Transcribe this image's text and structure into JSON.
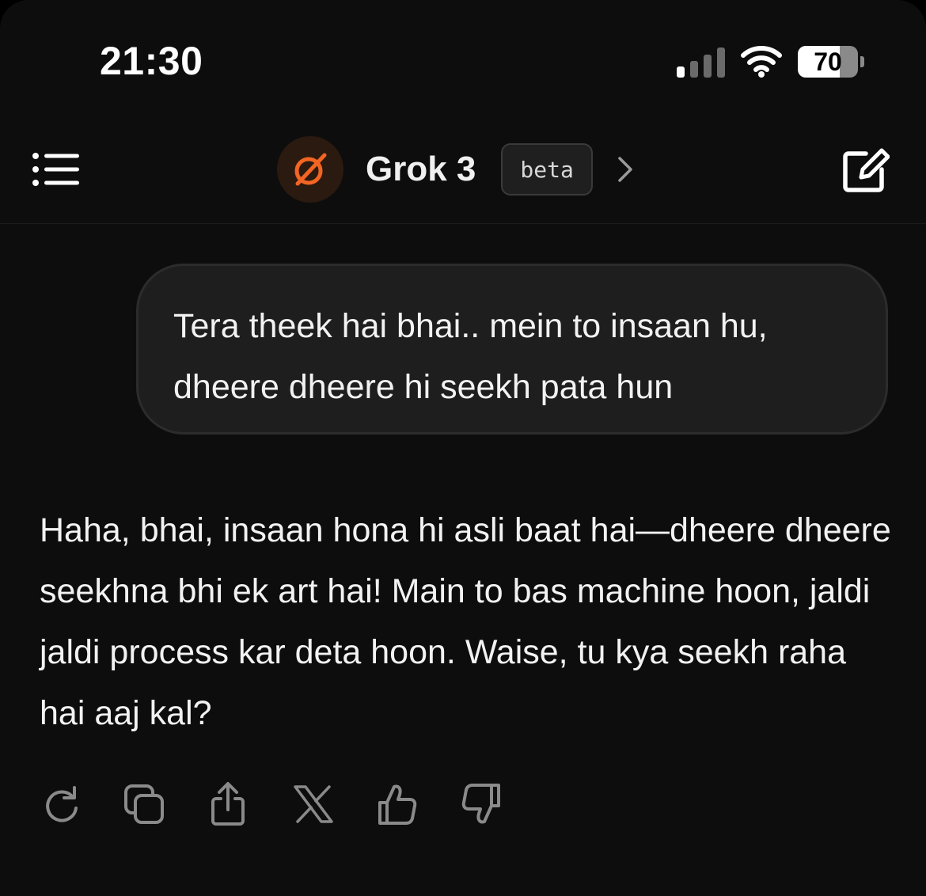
{
  "status_bar": {
    "time": "21:30",
    "battery_level": "70",
    "battery_fraction": 0.7
  },
  "header": {
    "model_name": "Grok 3",
    "badge": "beta",
    "accent_color": "#f26522"
  },
  "conversation": {
    "user_message": "Tera theek hai bhai.. mein to insaan hu, dheere dheere hi seekh pata hun",
    "assistant_message": "Haha, bhai, insaan hona hi asli baat hai—dheere dheere seekhna bhi ek art hai! Main to bas machine hoon, jaldi jaldi process kar deta hoon. Waise, tu kya seekh raha hai aaj kal?"
  },
  "actions": {
    "icons": [
      "regenerate-icon",
      "copy-icon",
      "share-icon",
      "x-logo-icon",
      "thumbs-up-icon",
      "thumbs-down-icon"
    ]
  }
}
